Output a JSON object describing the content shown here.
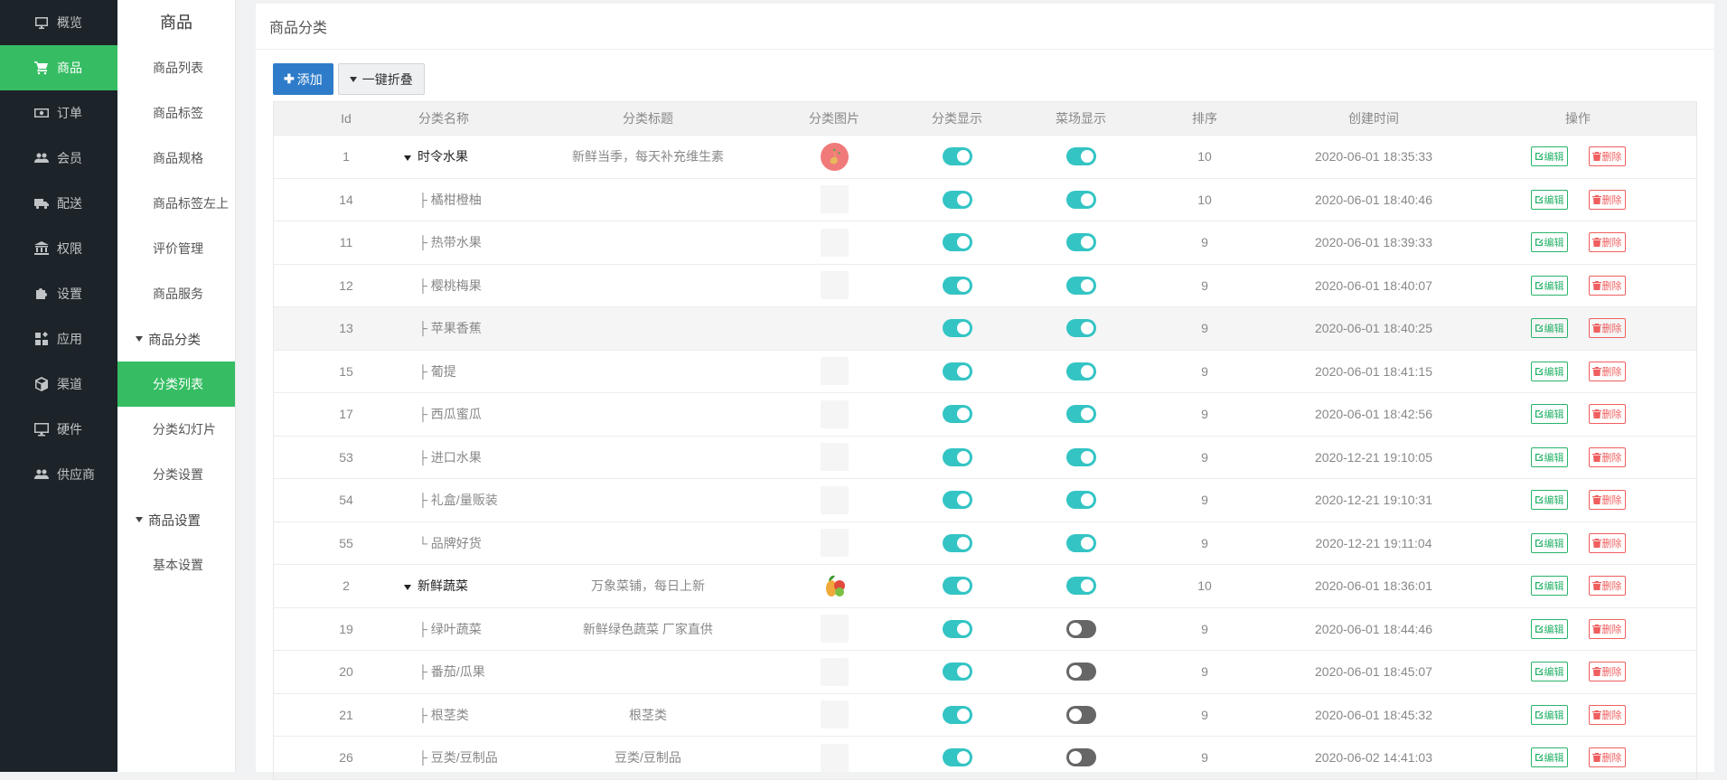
{
  "nav": [
    {
      "label": "概览",
      "icon": "monitor-icon"
    },
    {
      "label": "商品",
      "icon": "cart-icon",
      "active": true
    },
    {
      "label": "订单",
      "icon": "money-icon"
    },
    {
      "label": "会员",
      "icon": "users-icon"
    },
    {
      "label": "配送",
      "icon": "truck-icon"
    },
    {
      "label": "权限",
      "icon": "bank-icon"
    },
    {
      "label": "设置",
      "icon": "puzzle-icon"
    },
    {
      "label": "应用",
      "icon": "apps-icon"
    },
    {
      "label": "渠道",
      "icon": "cube-icon"
    },
    {
      "label": "硬件",
      "icon": "desktop-icon"
    },
    {
      "label": "供应商",
      "icon": "group-icon"
    }
  ],
  "sub": {
    "title": "商品",
    "items_top": [
      "商品列表",
      "商品标签",
      "商品规格",
      "商品标签左上",
      "评价管理",
      "商品服务"
    ],
    "group1": "商品分类",
    "group1_items": [
      "分类列表",
      "分类幻灯片",
      "分类设置"
    ],
    "group2": "商品设置",
    "group2_items": [
      "基本设置"
    ]
  },
  "main": {
    "title": "商品分类",
    "add_label": "添加",
    "fold_label": "一键折叠"
  },
  "table": {
    "headers": [
      "Id",
      "分类名称",
      "分类标题",
      "分类图片",
      "分类显示",
      "菜场显示",
      "排序",
      "创建时间",
      "操作"
    ],
    "edit_label": "编辑",
    "delete_label": "删除",
    "rows": [
      {
        "id": "1",
        "name": "时令水果",
        "parent": true,
        "title": "新鲜当季，每天补充维生素",
        "img": "fruit",
        "cat_show": true,
        "market_show": true,
        "sort": "10",
        "time": "2020-06-01 18:35:33"
      },
      {
        "id": "14",
        "name": "├ 橘柑橙柚",
        "parent": false,
        "title": "",
        "img": "empty",
        "cat_show": true,
        "market_show": true,
        "sort": "10",
        "time": "2020-06-01 18:40:46"
      },
      {
        "id": "11",
        "name": "├ 热带水果",
        "parent": false,
        "title": "",
        "img": "empty",
        "cat_show": true,
        "market_show": true,
        "sort": "9",
        "time": "2020-06-01 18:39:33"
      },
      {
        "id": "12",
        "name": "├ 樱桃梅果",
        "parent": false,
        "title": "",
        "img": "empty",
        "cat_show": true,
        "market_show": true,
        "sort": "9",
        "time": "2020-06-01 18:40:07"
      },
      {
        "id": "13",
        "name": "├ 苹果香蕉",
        "parent": false,
        "title": "",
        "img": "none",
        "cat_show": true,
        "market_show": true,
        "sort": "9",
        "time": "2020-06-01 18:40:25",
        "hl": true
      },
      {
        "id": "15",
        "name": "├ 葡提",
        "parent": false,
        "title": "",
        "img": "empty",
        "cat_show": true,
        "market_show": true,
        "sort": "9",
        "time": "2020-06-01 18:41:15"
      },
      {
        "id": "17",
        "name": "├ 西瓜蜜瓜",
        "parent": false,
        "title": "",
        "img": "empty",
        "cat_show": true,
        "market_show": true,
        "sort": "9",
        "time": "2020-06-01 18:42:56"
      },
      {
        "id": "53",
        "name": "├ 进口水果",
        "parent": false,
        "title": "",
        "img": "empty",
        "cat_show": true,
        "market_show": true,
        "sort": "9",
        "time": "2020-12-21 19:10:05"
      },
      {
        "id": "54",
        "name": "├ 礼盒/量贩装",
        "parent": false,
        "title": "",
        "img": "empty",
        "cat_show": true,
        "market_show": true,
        "sort": "9",
        "time": "2020-12-21 19:10:31"
      },
      {
        "id": "55",
        "name": "└ 品牌好货",
        "parent": false,
        "title": "",
        "img": "empty",
        "cat_show": true,
        "market_show": true,
        "sort": "9",
        "time": "2020-12-21 19:11:04"
      },
      {
        "id": "2",
        "name": "新鲜蔬菜",
        "parent": true,
        "title": "万象菜铺，每日上新",
        "img": "veg",
        "cat_show": true,
        "market_show": true,
        "sort": "10",
        "time": "2020-06-01 18:36:01"
      },
      {
        "id": "19",
        "name": "├ 绿叶蔬菜",
        "parent": false,
        "title": "新鲜绿色蔬菜 厂家直供",
        "img": "empty",
        "cat_show": true,
        "market_show": false,
        "sort": "9",
        "time": "2020-06-01 18:44:46"
      },
      {
        "id": "20",
        "name": "├ 番茄/瓜果",
        "parent": false,
        "title": "",
        "img": "empty",
        "cat_show": true,
        "market_show": false,
        "sort": "9",
        "time": "2020-06-01 18:45:07"
      },
      {
        "id": "21",
        "name": "├ 根茎类",
        "parent": false,
        "title": "根茎类",
        "img": "empty",
        "cat_show": true,
        "market_show": false,
        "sort": "9",
        "time": "2020-06-01 18:45:32"
      },
      {
        "id": "26",
        "name": "├ 豆类/豆制品",
        "parent": false,
        "title": "豆类/豆制品",
        "img": "empty",
        "cat_show": true,
        "market_show": false,
        "sort": "9",
        "time": "2020-06-02 14:41:03"
      }
    ]
  },
  "colors": {
    "accent_green": "#36bd63",
    "primary_blue": "#2e7cc9",
    "toggle_on": "#34c4c4",
    "toggle_off": "#666666",
    "danger": "#ef5f5f"
  }
}
